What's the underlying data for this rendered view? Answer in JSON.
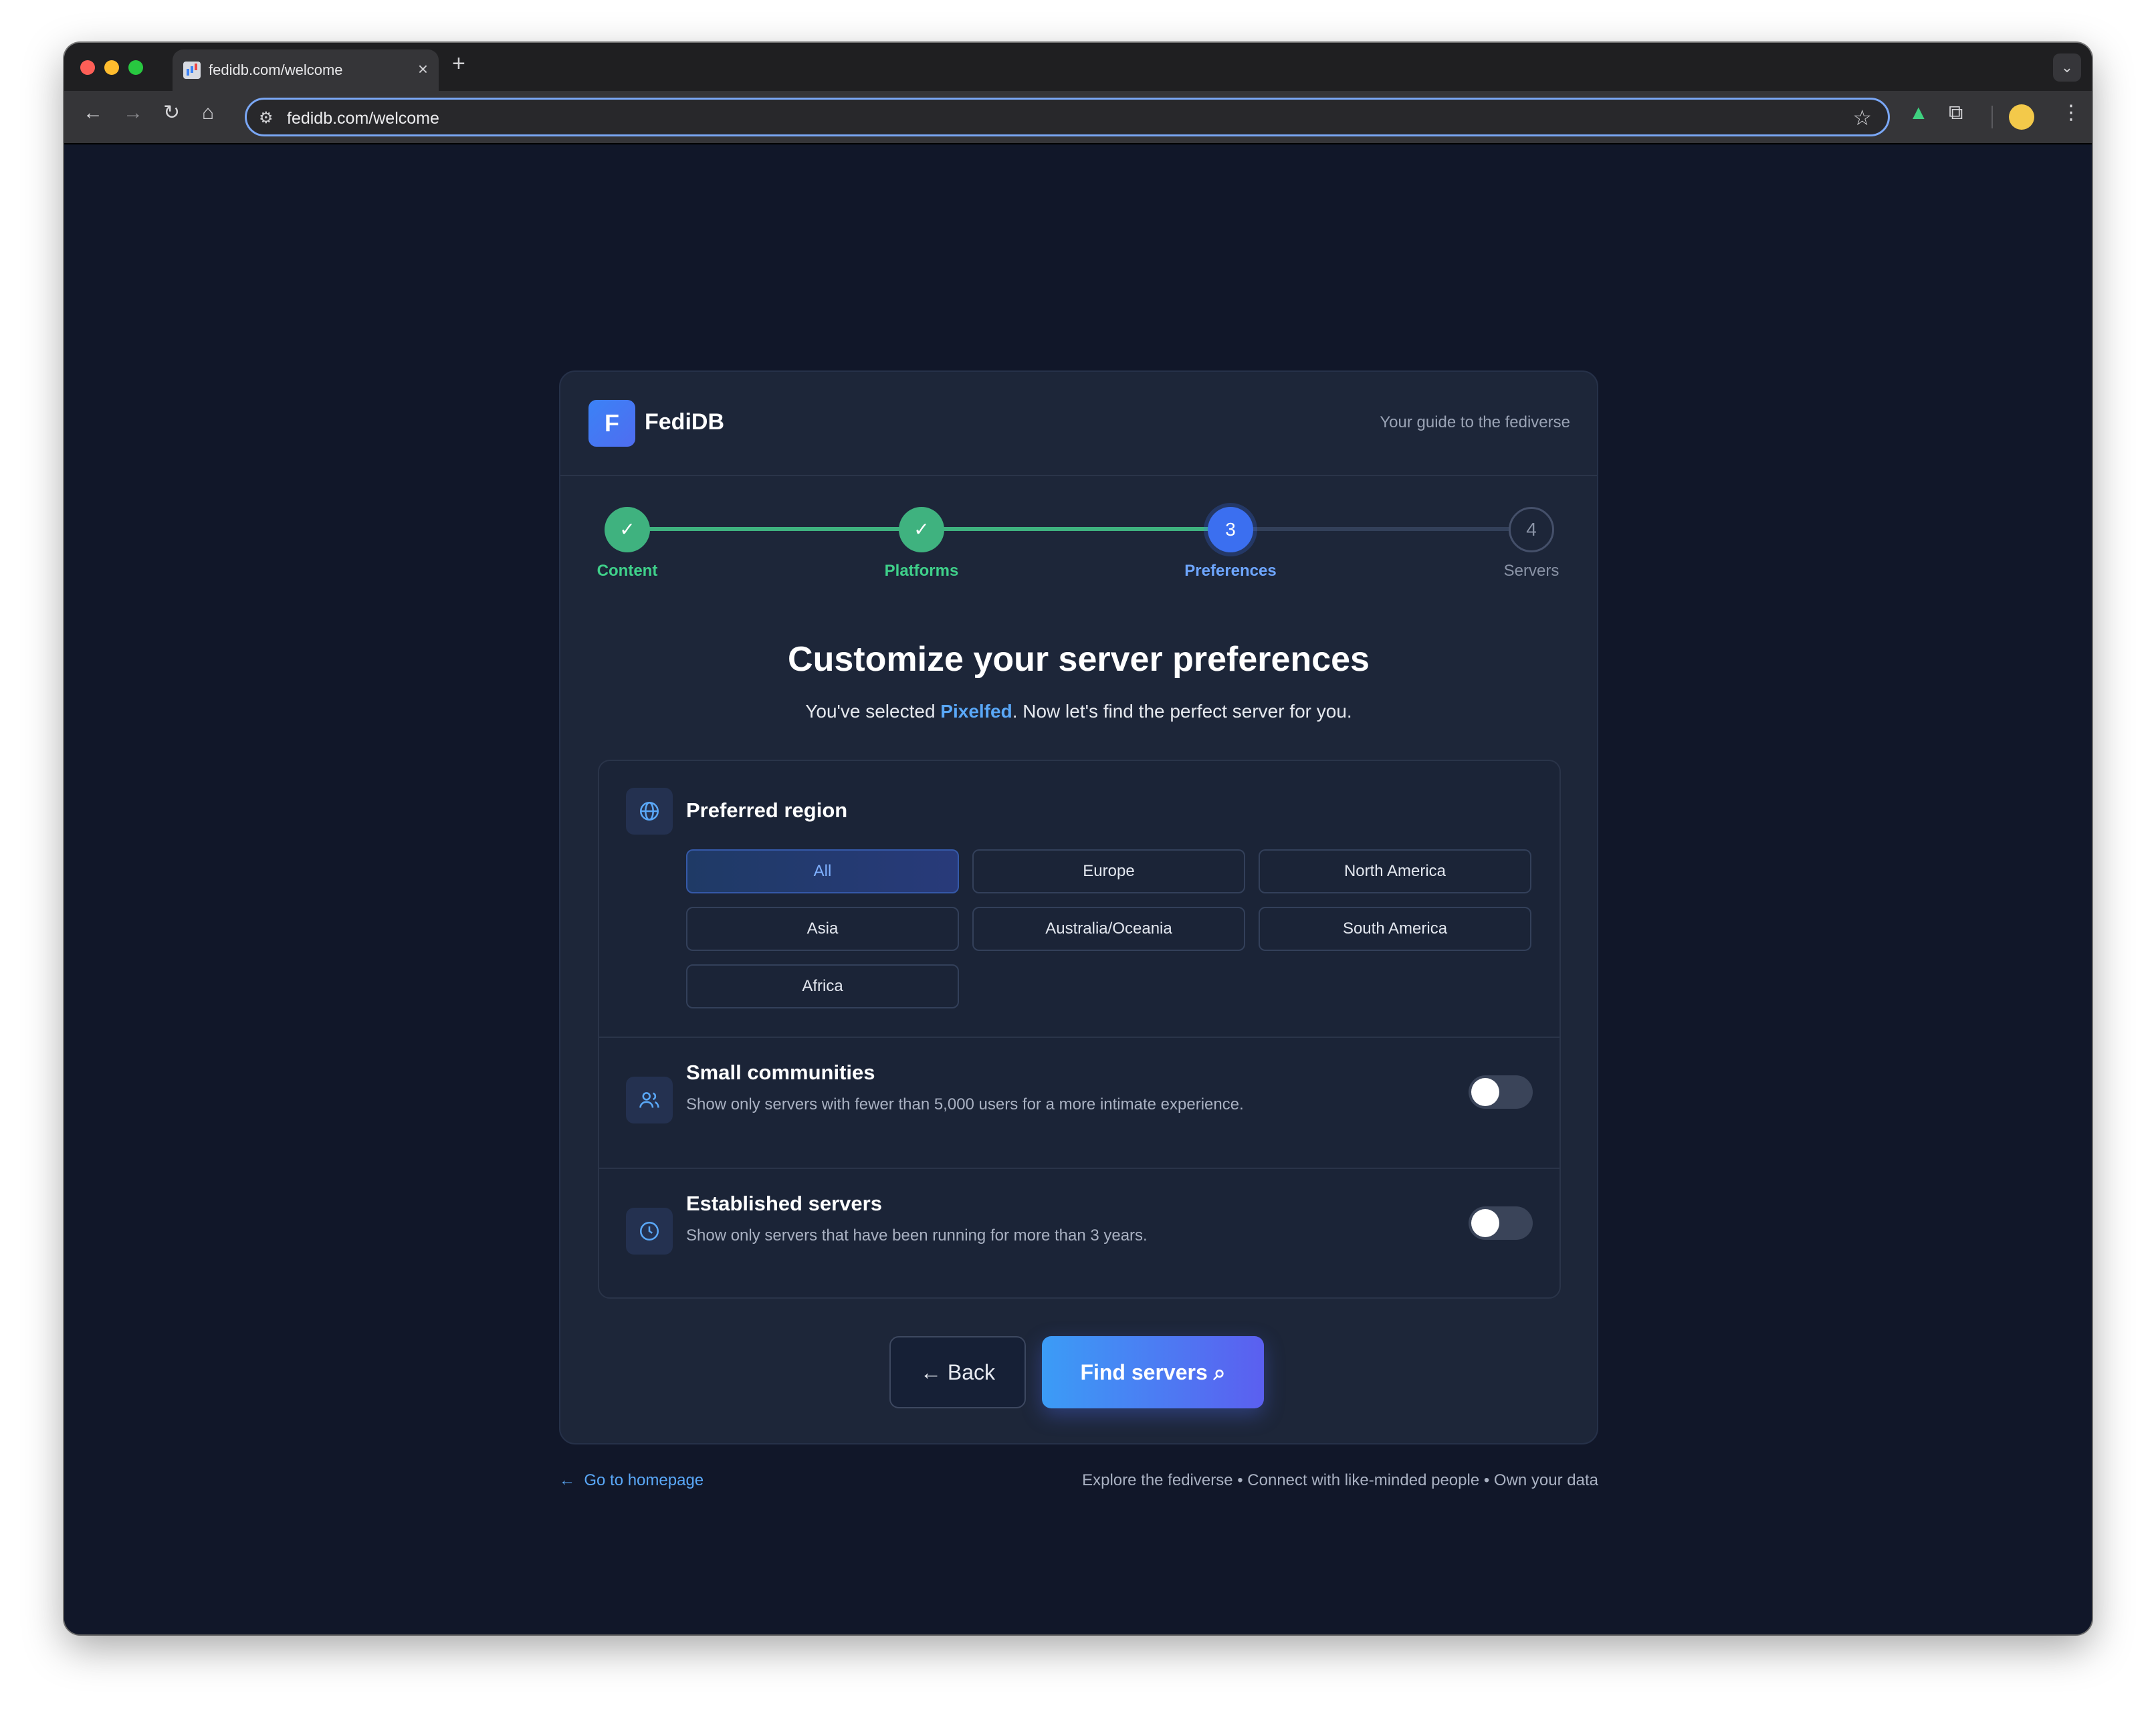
{
  "browser": {
    "tab_title": "fedidb.com/welcome",
    "url": "fedidb.com/welcome",
    "tab_close": "×",
    "new_tab": "+",
    "tab_menu": "⌄"
  },
  "header": {
    "logo_letter": "F",
    "logo_text": "FediDB",
    "tagline": "Your guide to the fediverse"
  },
  "stepper": {
    "steps": [
      {
        "label": "Content",
        "status": "complete",
        "marker": "✓"
      },
      {
        "label": "Platforms",
        "status": "complete",
        "marker": "✓"
      },
      {
        "label": "Preferences",
        "status": "active",
        "marker": "3"
      },
      {
        "label": "Servers",
        "status": "pending",
        "marker": "4"
      }
    ]
  },
  "main": {
    "title": "Customize your server preferences",
    "subtitle_prefix": "You've selected ",
    "subtitle_highlight": "Pixelfed",
    "subtitle_suffix": ". Now let's find the perfect server for you."
  },
  "region": {
    "title": "Preferred region",
    "options": [
      "All",
      "Europe",
      "North America",
      "Asia",
      "Australia/Oceania",
      "South America",
      "Africa"
    ],
    "selected": "All"
  },
  "small_communities": {
    "title": "Small communities",
    "description": "Show only servers with fewer than 5,000 users for a more intimate experience.",
    "enabled": false
  },
  "established": {
    "title": "Established servers",
    "description": "Show only servers that have been running for more than 3 years.",
    "enabled": false
  },
  "actions": {
    "back_label": "Back",
    "find_label": "Find servers"
  },
  "footer": {
    "home_link": "Go to homepage",
    "tagline": "Explore the fediverse • Connect with like-minded people • Own your data"
  },
  "colors": {
    "accent": "#3b82f6",
    "success": "#3fb27f",
    "page_bg": "#111729",
    "card_bg": "#1d2639"
  }
}
